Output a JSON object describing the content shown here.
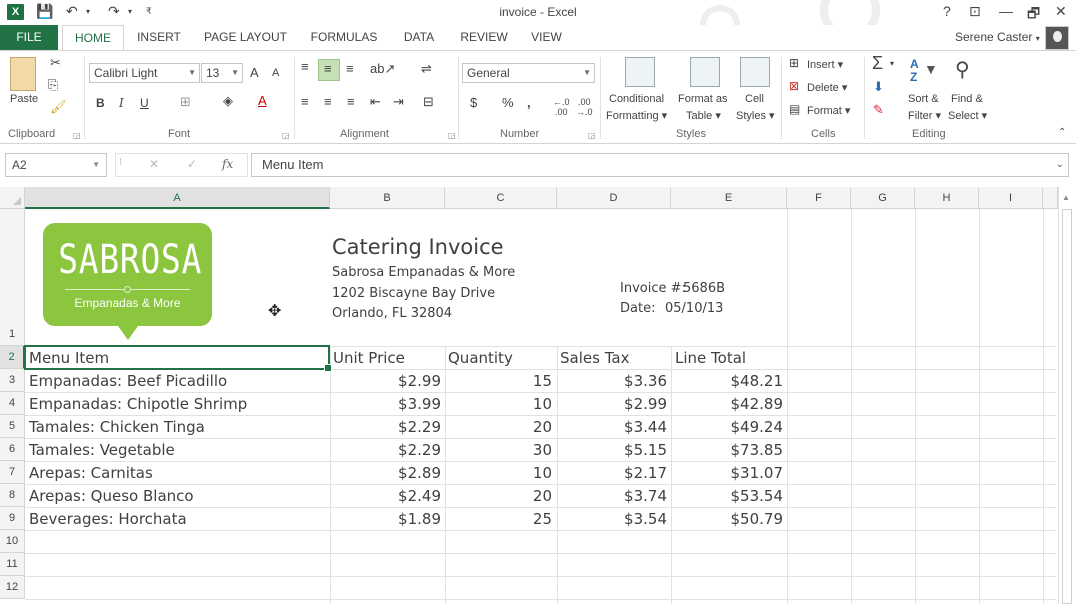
{
  "window": {
    "title": "invoice - Excel",
    "help": "?",
    "ribbon_display": "⊡",
    "minimize": "—",
    "restore": "🗗",
    "close": "✕"
  },
  "qat": {
    "save": "💾",
    "undo": "↶",
    "undo_arrow": "▾",
    "redo": "↷",
    "redo_arrow": "▾",
    "customize": "₹"
  },
  "tabs": {
    "file": "FILE",
    "items": [
      "HOME",
      "INSERT",
      "PAGE LAYOUT",
      "FORMULAS",
      "DATA",
      "REVIEW",
      "VIEW"
    ],
    "active": "HOME"
  },
  "user": {
    "name": "Serene Caster",
    "arrow": "▾"
  },
  "ribbon": {
    "clipboard": {
      "paste": "Paste",
      "label": "Clipboard"
    },
    "font": {
      "name": "Calibri Light",
      "size": "13",
      "grow": "A",
      "shrink": "A",
      "bold": "B",
      "italic": "I",
      "underline": "U",
      "label": "Font"
    },
    "alignment": {
      "label": "Alignment"
    },
    "number": {
      "format": "General",
      "currency": "$",
      "percent": "%",
      "comma": ",",
      "inc_decimal": "⁺.0 .00",
      "dec_decimal": ".00 →.0",
      "label": "Number"
    },
    "styles": {
      "conditional_1": "Conditional",
      "conditional_2": "Formatting ▾",
      "format_table_1": "Format as",
      "format_table_2": "Table ▾",
      "cell_styles_1": "Cell",
      "cell_styles_2": "Styles ▾",
      "label": "Styles"
    },
    "cells": {
      "insert": "Insert",
      "delete": "Delete",
      "format": "Format",
      "label": "Cells"
    },
    "editing": {
      "sum": "Σ",
      "sort_1": "Sort &",
      "sort_2": "Filter ▾",
      "find_1": "Find &",
      "find_2": "Select ▾",
      "label": "Editing"
    }
  },
  "formula_bar": {
    "name_box": "A2",
    "cancel": "✕",
    "enter": "✓",
    "fx": "fx",
    "content": "Menu Item"
  },
  "columns": [
    "A",
    "B",
    "C",
    "D",
    "E",
    "F",
    "G",
    "H",
    "I"
  ],
  "rows": [
    "1",
    "2",
    "3",
    "4",
    "5",
    "6",
    "7",
    "8",
    "9",
    "10",
    "11",
    "12"
  ],
  "logo": {
    "name": "SABROSA",
    "tagline": "Empanadas & More"
  },
  "invoice": {
    "title": "Catering Invoice",
    "company": "Sabrosa Empanadas & More",
    "address1": "1202 Biscayne Bay Drive",
    "address2": "Orlando, FL 32804",
    "invoice_label": "Invoice #:",
    "invoice_no": "5686B",
    "date_label": "Date:",
    "date": "05/10/13"
  },
  "table": {
    "headers": [
      "Menu Item",
      "Unit Price",
      "Quantity",
      "Sales Tax",
      "Line Total"
    ],
    "rows": [
      [
        "Empanadas: Beef Picadillo",
        "$2.99",
        "15",
        "$3.36",
        "$48.21"
      ],
      [
        "Empanadas: Chipotle Shrimp",
        "$3.99",
        "10",
        "$2.99",
        "$42.89"
      ],
      [
        "Tamales: Chicken Tinga",
        "$2.29",
        "20",
        "$3.44",
        "$49.24"
      ],
      [
        "Tamales: Vegetable",
        "$2.29",
        "30",
        "$5.15",
        "$73.85"
      ],
      [
        "Arepas: Carnitas",
        "$2.89",
        "10",
        "$2.17",
        "$31.07"
      ],
      [
        "Arepas: Queso Blanco",
        "$2.49",
        "20",
        "$3.74",
        "$53.54"
      ],
      [
        "Beverages: Horchata",
        "$1.89",
        "25",
        "$3.54",
        "$50.79"
      ]
    ]
  },
  "colors": {
    "excel_green": "#217346",
    "logo_green": "#8cc63f"
  }
}
